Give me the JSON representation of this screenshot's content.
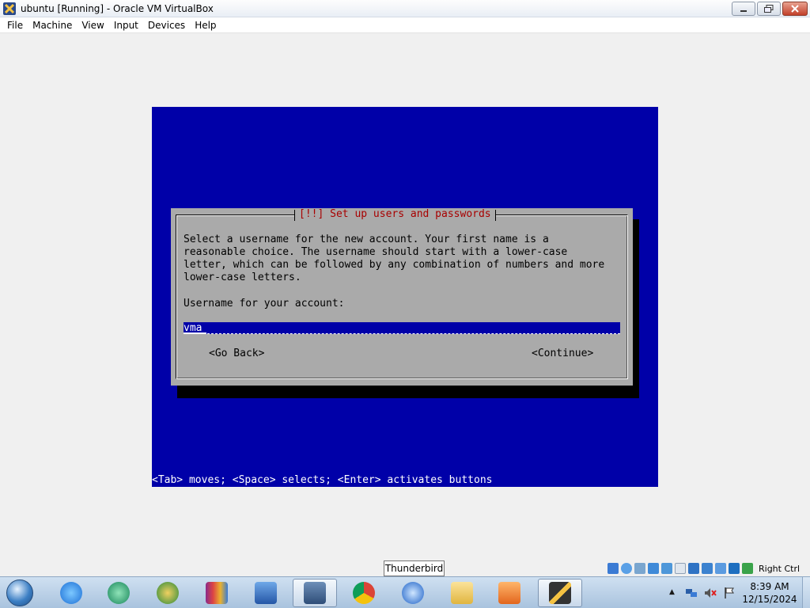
{
  "window": {
    "title": "ubuntu [Running] - Oracle VM VirtualBox",
    "app_icon": "virtualbox-icon"
  },
  "menu": {
    "items": [
      "File",
      "Machine",
      "View",
      "Input",
      "Devices",
      "Help"
    ]
  },
  "installer": {
    "dialog_title": "[!!] Set up users and passwords",
    "description": "Select a username for the new account. Your first name is a\nreasonable choice. The username should start with a lower-case\nletter, which can be followed by any combination of numbers and more\nlower-case letters.",
    "field_label": "Username for your account:",
    "username_value": "vma",
    "go_back_label": "<Go Back>",
    "continue_label": "<Continue>",
    "help_line": "<Tab> moves; <Space> selects; <Enter> activates buttons",
    "colors": {
      "screen_bg": "#0000a8",
      "dialog_bg": "#aaaaaa",
      "title_text": "#a80000"
    }
  },
  "tooltip": {
    "text": "Thunderbird"
  },
  "vbox_status": {
    "host_key": "Right Ctrl",
    "icons": [
      "hard-disk-icon",
      "optical-drive-icon",
      "audio-icon",
      "network-icon",
      "usb-icon",
      "shared-folders-icon",
      "display-icon",
      "video-capture-icon",
      "cpu-icon",
      "virtualization-icon",
      "mouse-integration-icon"
    ]
  },
  "taskbar": {
    "apps": [
      "internet-explorer-icon",
      "media-app-icon",
      "network-globe-icon",
      "winrar-icon",
      "remote-desktop-icon",
      "virtualbox-icon",
      "chrome-icon",
      "thunderbird-icon",
      "file-explorer-icon",
      "media-player-icon",
      "virtualbox-vm-icon"
    ],
    "clock_time": "8:39 AM",
    "clock_date": "12/15/2024"
  }
}
